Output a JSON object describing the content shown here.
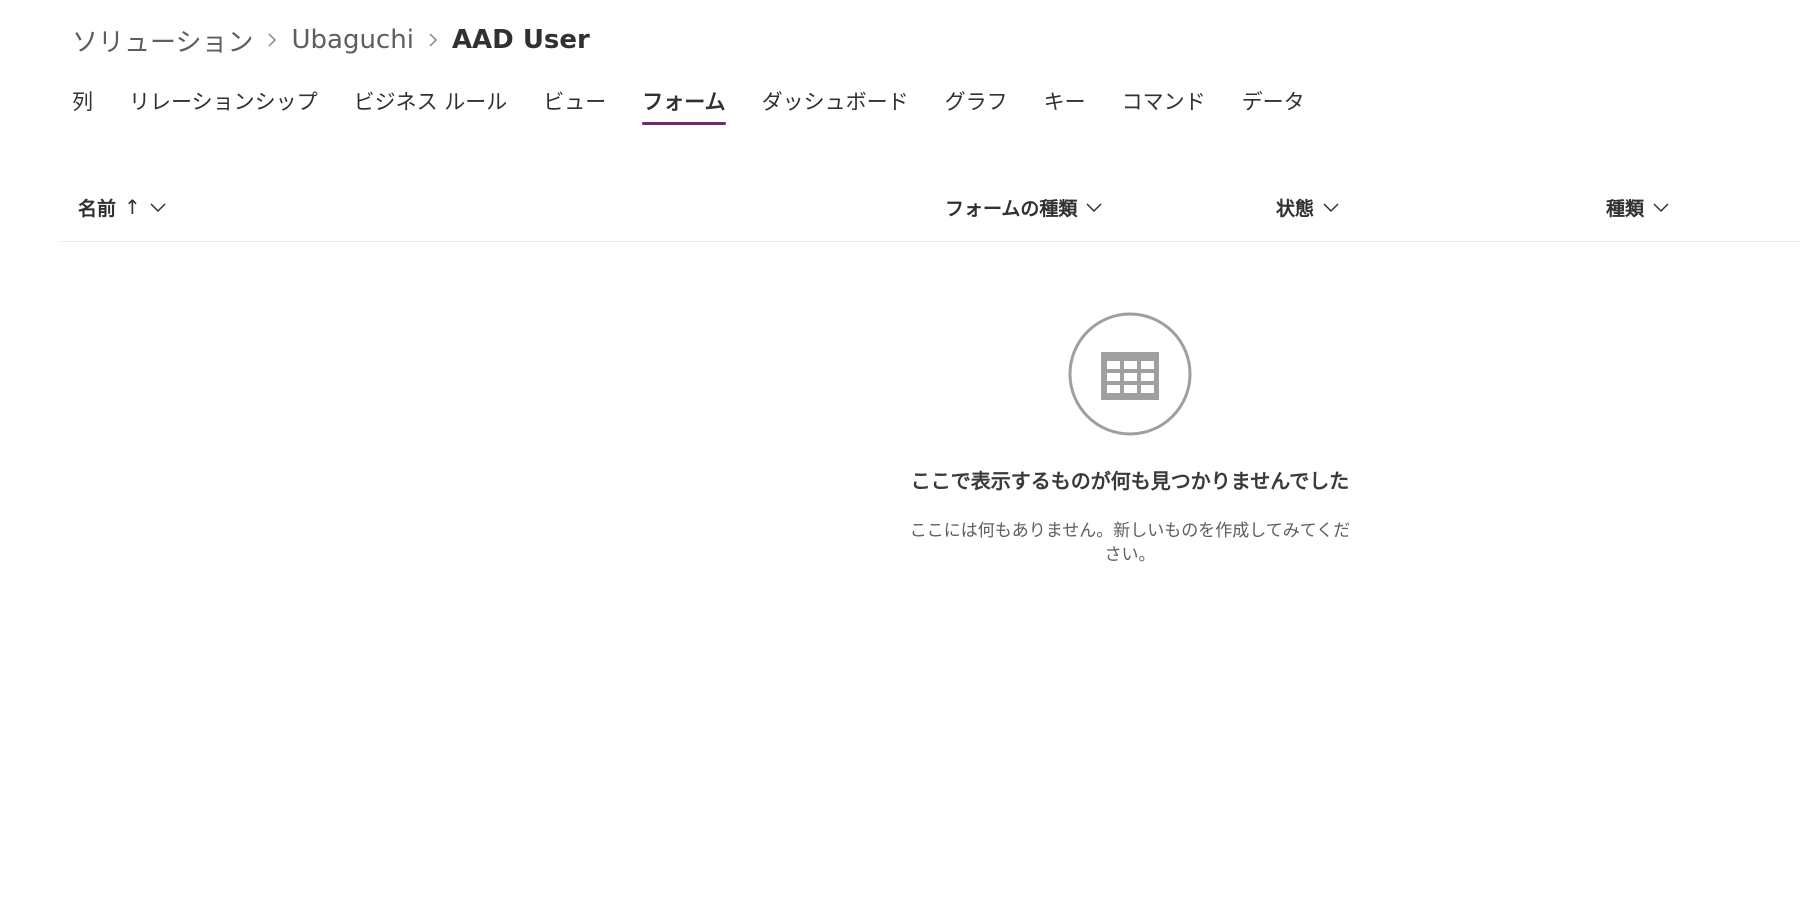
{
  "breadcrumb": {
    "items": [
      "ソリューション",
      "Ubaguchi",
      "AAD User"
    ],
    "separator_icon": "chevron-right-icon"
  },
  "tabs": [
    {
      "label": "列",
      "active": false
    },
    {
      "label": "リレーションシップ",
      "active": false
    },
    {
      "label": "ビジネス ルール",
      "active": false
    },
    {
      "label": "ビュー",
      "active": false
    },
    {
      "label": "フォーム",
      "active": true
    },
    {
      "label": "ダッシュボード",
      "active": false
    },
    {
      "label": "グラフ",
      "active": false
    },
    {
      "label": "キー",
      "active": false
    },
    {
      "label": "コマンド",
      "active": false
    },
    {
      "label": "データ",
      "active": false
    }
  ],
  "table": {
    "columns": [
      {
        "label": "名前",
        "sort_indicator": "↑"
      },
      {
        "label": "フォームの種類"
      },
      {
        "label": "状態"
      },
      {
        "label": "種類"
      }
    ]
  },
  "empty_state": {
    "icon": "table-grid-icon",
    "title": "ここで表示するものが何も見つかりませんでした",
    "subtitle": "ここには何もありません。新しいものを作成してみてください。"
  },
  "colors": {
    "accent": "#742774",
    "text": "#323130",
    "muted": "#605e5c",
    "icon_gray": "#a19f9d",
    "divider": "#edebe9"
  }
}
